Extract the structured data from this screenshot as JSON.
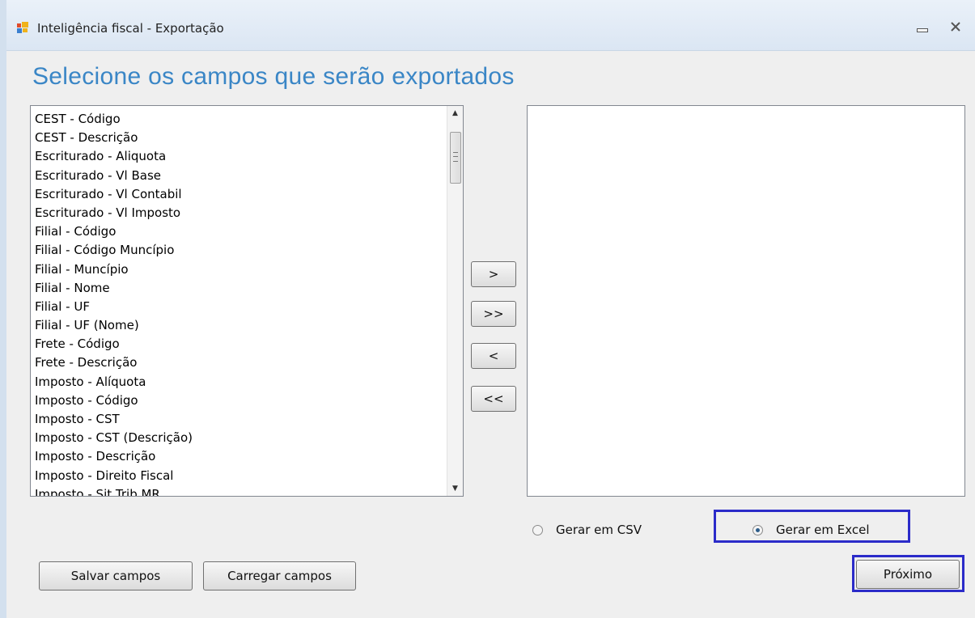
{
  "window": {
    "title": "Inteligência fiscal - Exportação"
  },
  "heading": "Selecione os campos que serão exportados",
  "available_fields": [
    "CEST - Código",
    "CEST - Descrição",
    "Escriturado - Aliquota",
    "Escriturado - Vl Base",
    "Escriturado - Vl Contabil",
    "Escriturado - Vl Imposto",
    "Filial - Código",
    "Filial - Código Muncípio",
    "Filial - Muncípio",
    "Filial - Nome",
    "Filial - UF",
    "Filial - UF (Nome)",
    "Frete - Código",
    "Frete - Descrição",
    "Imposto - Alíquota",
    "Imposto - Código",
    "Imposto - CST",
    "Imposto - CST (Descrição)",
    "Imposto - Descrição",
    "Imposto - Direito Fiscal",
    "Imposto - Sit Trib MR"
  ],
  "selected_fields": [],
  "transfer_buttons": {
    "add": ">",
    "add_all": ">>",
    "remove": "<",
    "remove_all": "<<"
  },
  "output_format": {
    "csv_label": "Gerar em CSV",
    "excel_label": "Gerar em Excel",
    "selected": "excel"
  },
  "buttons": {
    "save": "Salvar campos",
    "load": "Carregar campos",
    "next": "Próximo"
  },
  "colors": {
    "heading": "#3a86c6",
    "highlight": "#2b2bc9"
  }
}
